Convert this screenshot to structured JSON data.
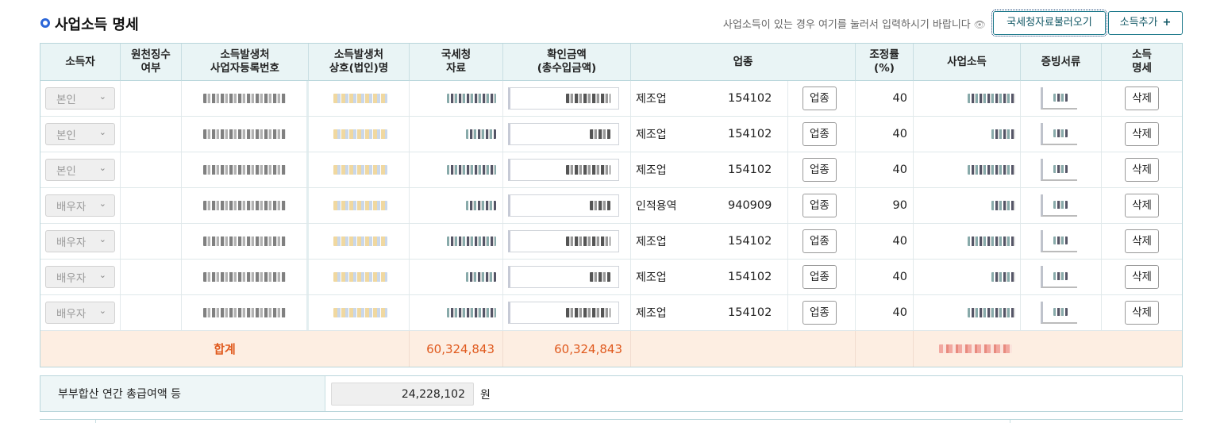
{
  "header": {
    "title": "사업소득 명세",
    "hint": "사업소득이 있는 경우 여기를 눌러서 입력하시기 바랍니다",
    "hint_icon": "eye-icon",
    "load_button": "국세청자료불러오기",
    "add_button": "소득추가",
    "add_icon": "plus-icon"
  },
  "table": {
    "columns": [
      "소득자",
      "원천징수\n여부",
      "소득발생처\n사업자등록번호",
      "소득발생처\n상호(법인)명",
      "국세청\n자료",
      "확인금액\n(총수입금액)",
      "업종",
      "조정률\n(%)",
      "사업소득",
      "증빙서류",
      "소득\n명세"
    ],
    "industry_button": "업종",
    "delete_button": "삭제",
    "rows": [
      {
        "earner": "본인",
        "industry": "제조업",
        "code": "154102",
        "rate": "40"
      },
      {
        "earner": "본인",
        "industry": "제조업",
        "code": "154102",
        "rate": "40"
      },
      {
        "earner": "본인",
        "industry": "제조업",
        "code": "154102",
        "rate": "40"
      },
      {
        "earner": "배우자",
        "industry": "인적용역",
        "code": "940909",
        "rate": "90"
      },
      {
        "earner": "배우자",
        "industry": "제조업",
        "code": "154102",
        "rate": "40"
      },
      {
        "earner": "배우자",
        "industry": "제조업",
        "code": "154102",
        "rate": "40"
      },
      {
        "earner": "배우자",
        "industry": "제조업",
        "code": "154102",
        "rate": "40"
      }
    ],
    "total": {
      "label": "합계",
      "nts_amount": "60,324,843",
      "confirmed_amount": "60,324,843"
    }
  },
  "spouse": {
    "label": "부부합산 연간 총급여액 등",
    "value": "24,228,102",
    "unit": "원"
  },
  "colors": {
    "header_bg": "#e9f4f5",
    "border": "#b9d6db",
    "total_bg": "#fdeee2",
    "total_text": "#e05a1e",
    "accent": "#2c66d8"
  }
}
